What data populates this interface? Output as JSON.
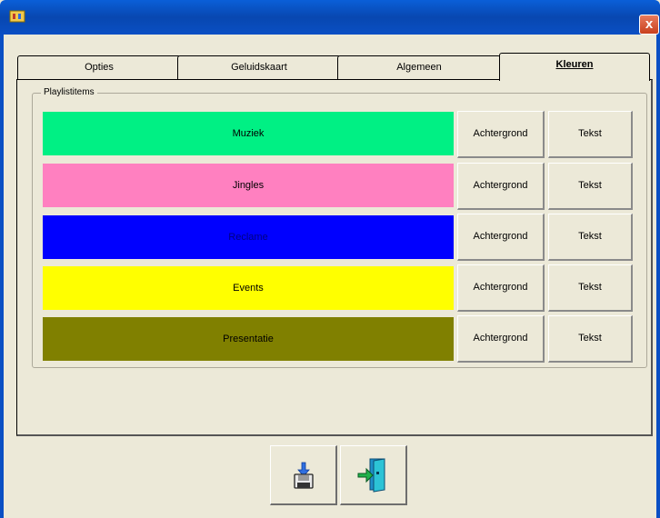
{
  "window": {
    "close_label": "x"
  },
  "tabs": [
    {
      "label": "Opties",
      "active": false
    },
    {
      "label": "Geluidskaart",
      "active": false
    },
    {
      "label": "Algemeen",
      "active": false
    },
    {
      "label": "Kleuren",
      "active": true
    }
  ],
  "group": {
    "label": "Playlistitems"
  },
  "items": [
    {
      "label": "Muziek",
      "background_color": "#00f084",
      "text_color": "#000000",
      "background_button": "Achtergrond",
      "text_button": "Tekst"
    },
    {
      "label": "Jingles",
      "background_color": "#ff80c0",
      "text_color": "#000000",
      "background_button": "Achtergrond",
      "text_button": "Tekst"
    },
    {
      "label": "Reclame",
      "background_color": "#0000ff",
      "text_color": "#000080",
      "background_button": "Achtergrond",
      "text_button": "Tekst"
    },
    {
      "label": "Events",
      "background_color": "#ffff00",
      "text_color": "#000000",
      "background_button": "Achtergrond",
      "text_button": "Tekst"
    },
    {
      "label": "Presentatie",
      "background_color": "#808000",
      "text_color": "#000000",
      "background_button": "Achtergrond",
      "text_button": "Tekst"
    }
  ],
  "footer": {
    "buttons": [
      {
        "icon": "save-icon"
      },
      {
        "icon": "exit-door-icon"
      }
    ]
  }
}
